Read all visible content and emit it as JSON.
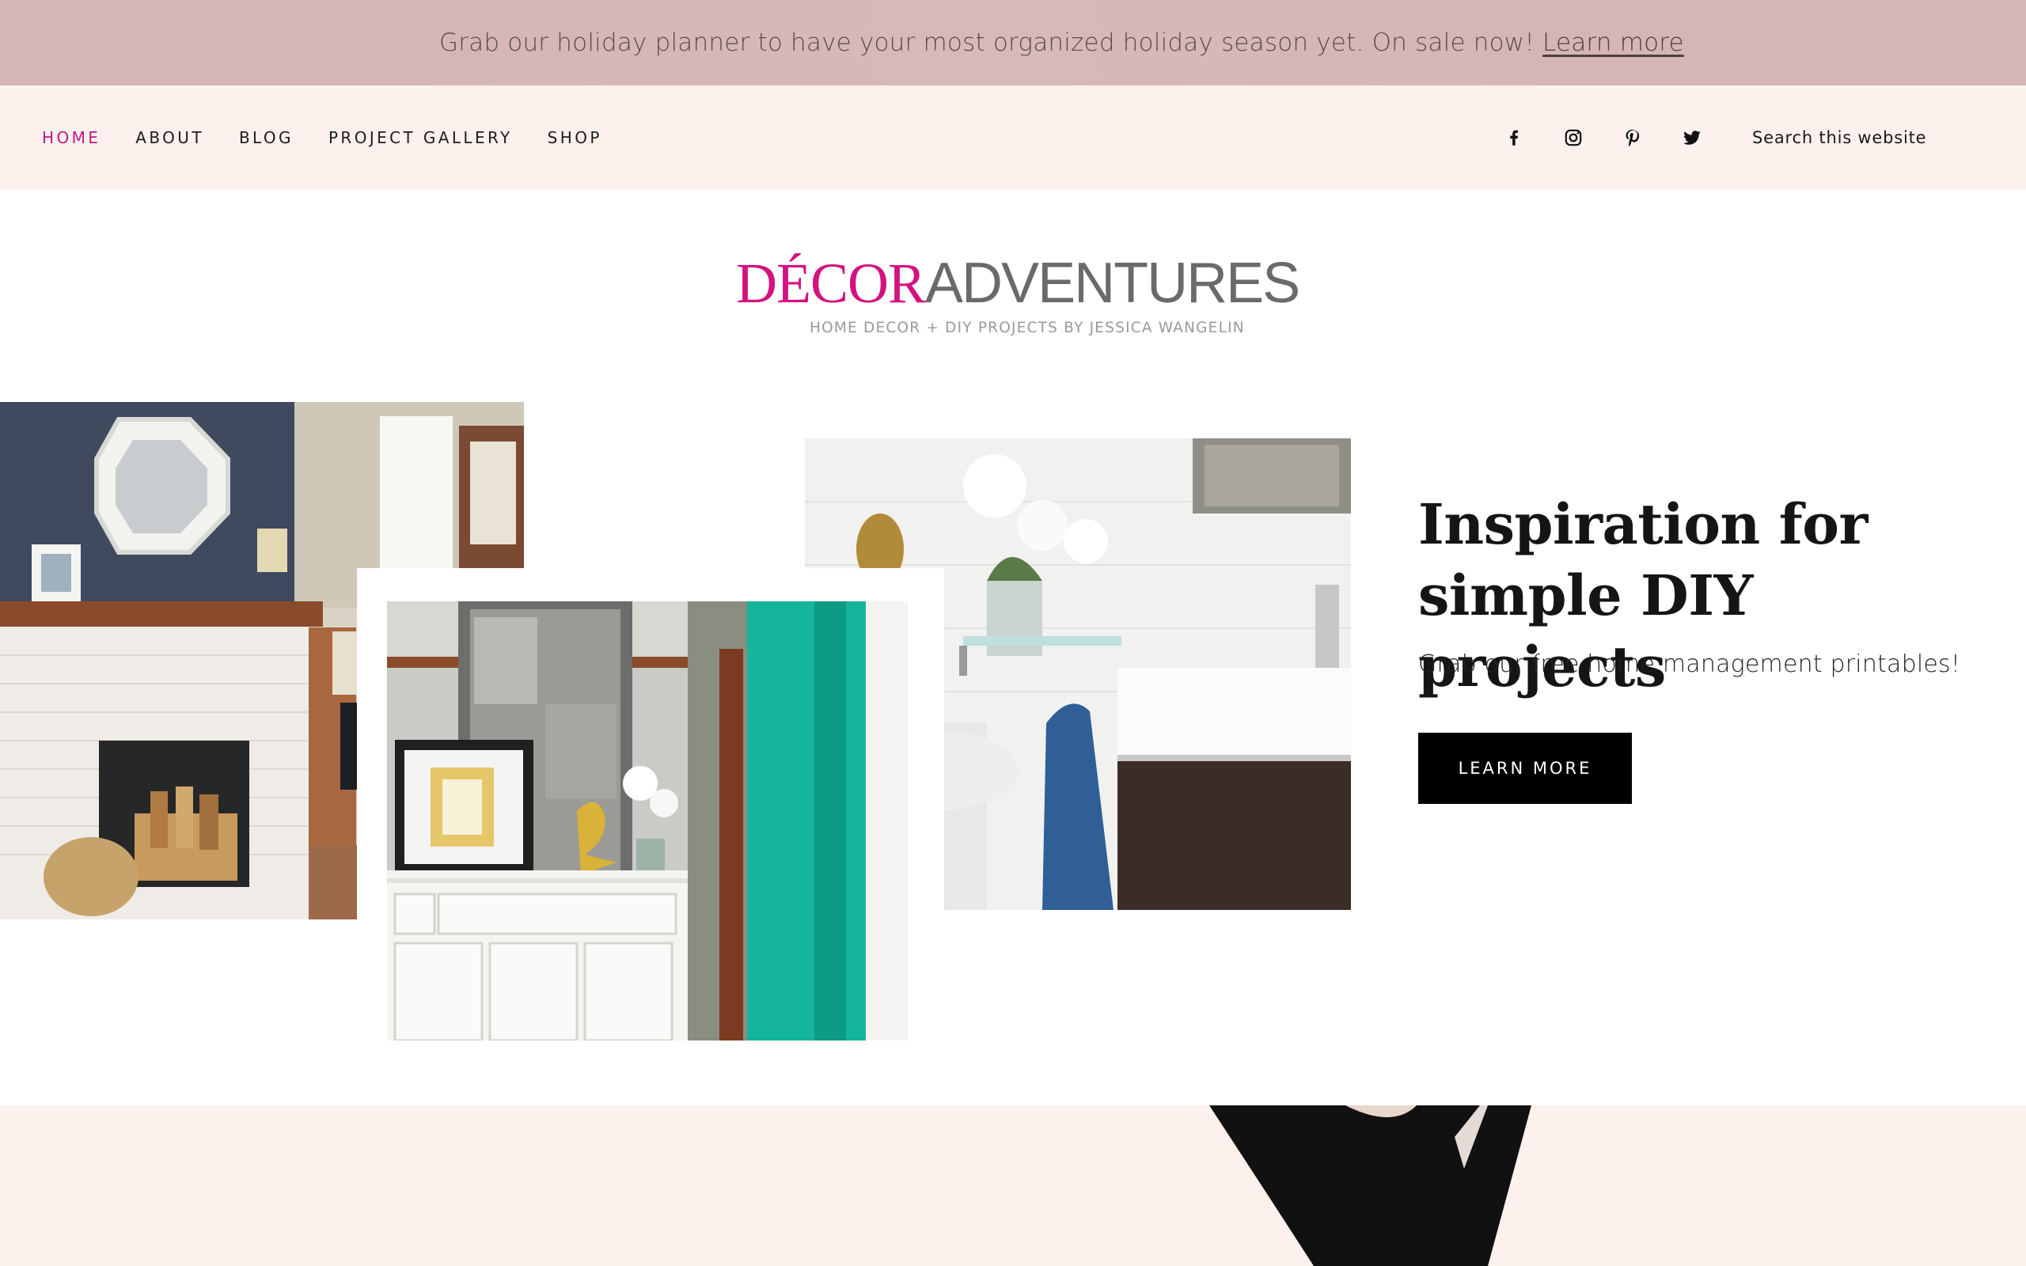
{
  "announcement": {
    "text": "Grab our holiday planner to have your most organized holiday season yet. On sale now! ",
    "link_label": "Learn more"
  },
  "nav": {
    "items": [
      {
        "label": "HOME",
        "active": true
      },
      {
        "label": "ABOUT",
        "active": false
      },
      {
        "label": "BLOG",
        "active": false
      },
      {
        "label": "PROJECT GALLERY",
        "active": false
      },
      {
        "label": "SHOP",
        "active": false
      }
    ],
    "social_icons": [
      "facebook-icon",
      "instagram-icon",
      "pinterest-icon",
      "twitter-icon"
    ],
    "search_placeholder": "Search this website"
  },
  "logo": {
    "word1": "DÉCOR",
    "word2": "ADVENTURES",
    "tagline": "HOME DECOR + DIY PROJECTS BY JESSICA WANGELIN"
  },
  "hero": {
    "title": "Inspiration for simple DIY projects",
    "subtitle": "Grab our free home management printables!",
    "button_label": "LEARN MORE"
  },
  "colors": {
    "accent": "#c2188a",
    "logo_pink": "#d4127f",
    "announce_bg": "#d5b5b5",
    "nav_bg": "#fcf1ec",
    "button_bg": "#000000"
  }
}
